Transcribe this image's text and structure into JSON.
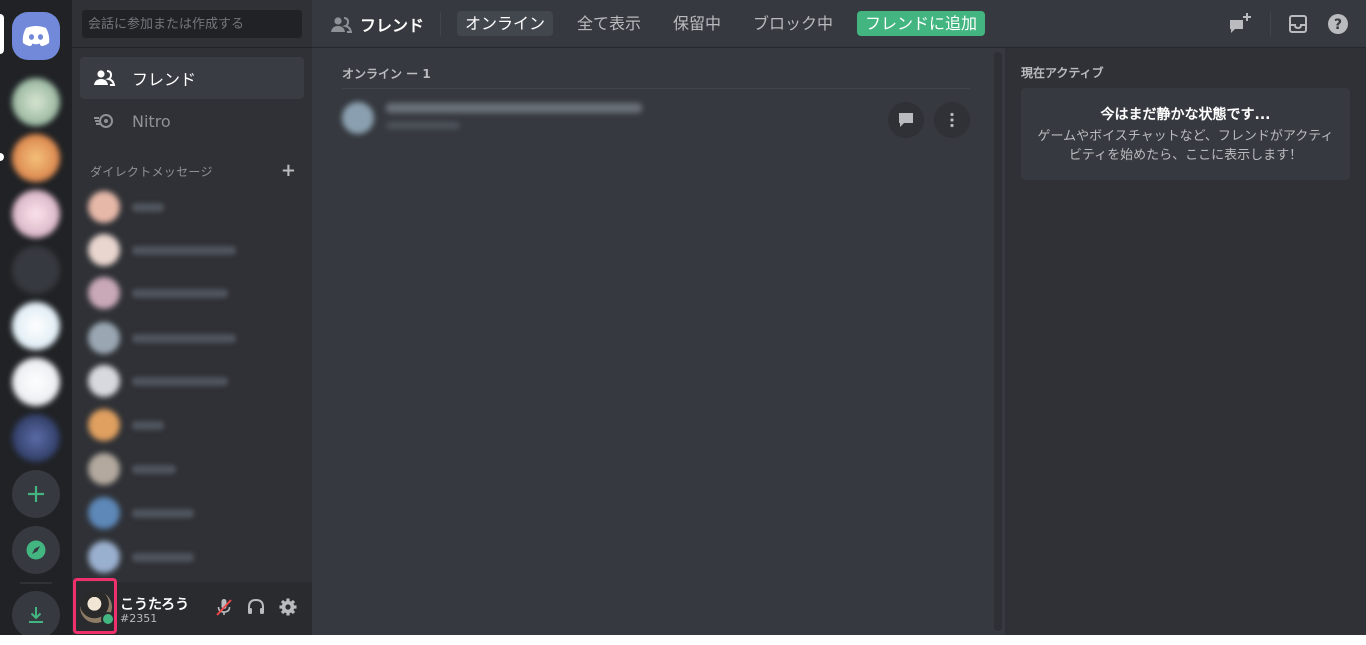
{
  "search": {
    "placeholder": "会話に参加または作成する"
  },
  "sidebar": {
    "nav": [
      {
        "label": "フレンド",
        "icon": "friends-icon",
        "active": true
      },
      {
        "label": "Nitro",
        "icon": "nitro-icon",
        "active": false
      }
    ],
    "dm_header": "ダイレクトメッセージ",
    "dm_add_icon": "plus-icon"
  },
  "user": {
    "name": "こうたろう",
    "tag": "#2351",
    "status_color": "#43b581"
  },
  "header": {
    "title": "フレンド",
    "tabs": [
      {
        "label": "オンライン",
        "selected": true
      },
      {
        "label": "全て表示",
        "selected": false
      },
      {
        "label": "保留中",
        "selected": false
      },
      {
        "label": "ブロック中",
        "selected": false
      }
    ],
    "add_friend": "フレンドに追加",
    "icons": [
      "new-group-dm-icon",
      "inbox-icon",
      "help-icon"
    ]
  },
  "main": {
    "section_title": "オンライン ー 1"
  },
  "activity": {
    "title": "現在アクティブ",
    "empty_title": "今はまだ静かな状態です...",
    "empty_text": "ゲームやボイスチャットなど、フレンドがアクティビティを始めたら、ここに表示します！"
  },
  "colors": {
    "brand": "#7289da",
    "online": "#43b581",
    "highlight": "#f0306c"
  }
}
